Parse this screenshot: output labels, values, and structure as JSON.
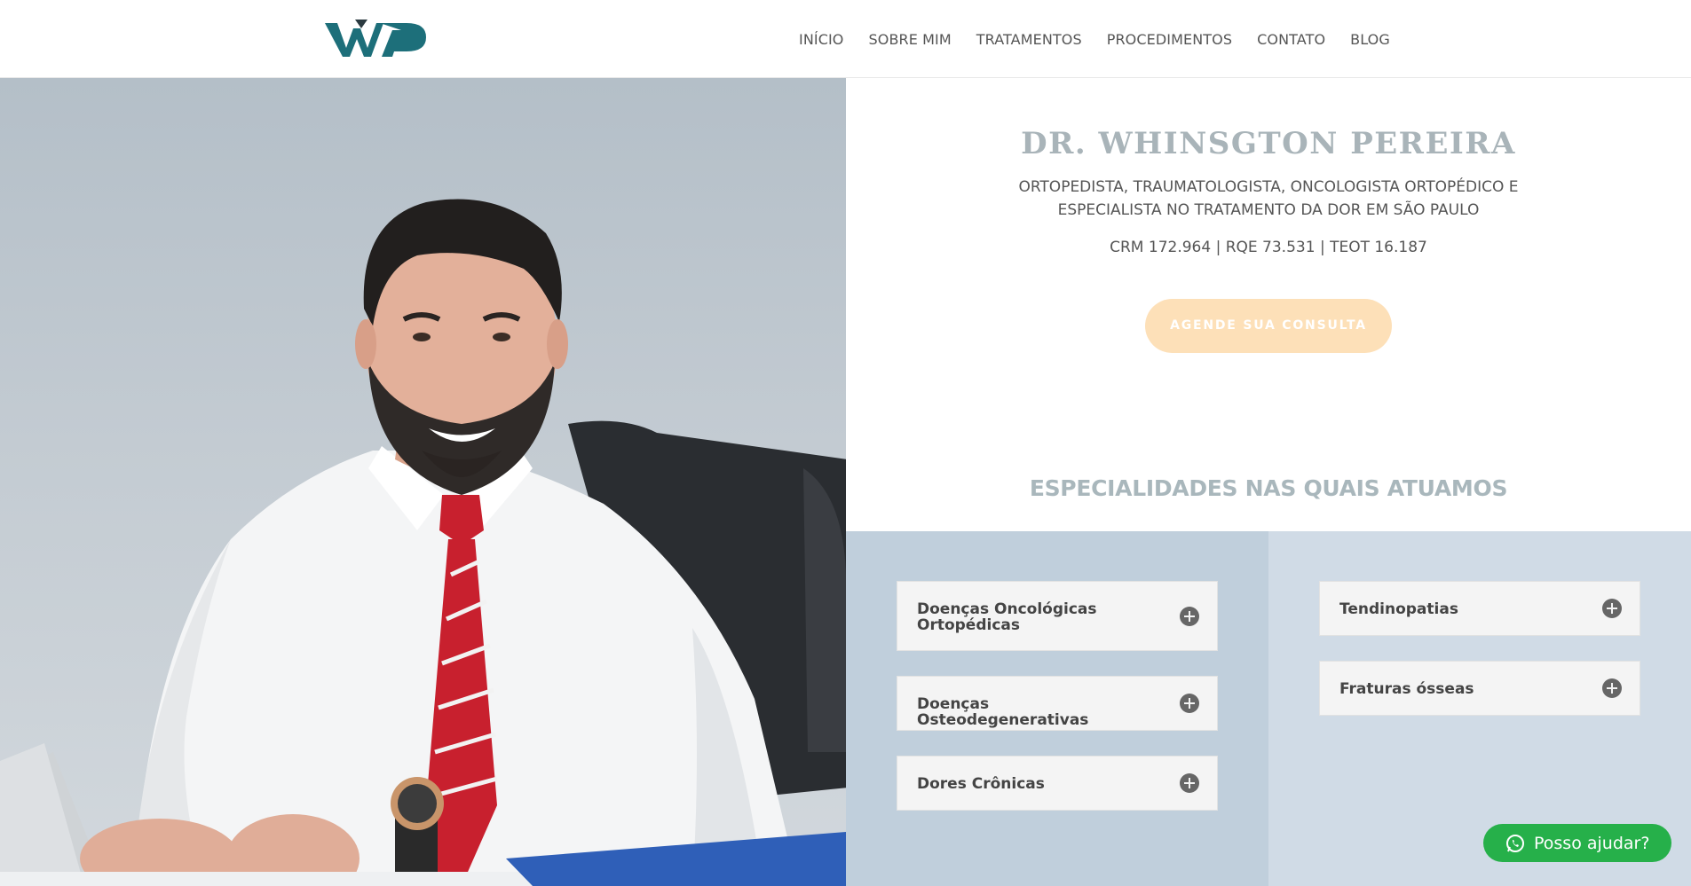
{
  "header": {
    "logo_text": "WP",
    "nav": [
      "INÍCIO",
      "SOBRE MIM",
      "TRATAMENTOS",
      "PROCEDIMENTOS",
      "CONTATO",
      "BLOG"
    ]
  },
  "hero": {
    "title": "DR. WHINSGTON PEREIRA",
    "subtitle_line1": "ORTOPEDISTA, TRAUMATOLOGISTA, ONCOLOGISTA ORTOPÉDICO E",
    "subtitle_line2": "ESPECIALISTA NO TRATAMENTO DA DOR EM SÃO PAULO",
    "credentials": "CRM 172.964 | RQE 73.531 | TEOT 16.187",
    "cta_label": "AGENDE SUA CONSULTA"
  },
  "specialties": {
    "heading": "ESPECIALIDADES NAS QUAIS ATUAMOS",
    "left": [
      {
        "line1": "Doenças Oncológicas",
        "line2": "Ortopédicas"
      },
      {
        "line1": "Doenças Osteodegenerativas",
        "line2": ""
      },
      {
        "line1": "Dores Crônicas",
        "line2": ""
      }
    ],
    "right": [
      {
        "line1": "Tendinopatias",
        "line2": ""
      },
      {
        "line1": "Fraturas ósseas",
        "line2": ""
      }
    ]
  },
  "whatsapp": {
    "label": "Posso ajudar?"
  },
  "colors": {
    "brand_teal": "#1d6f7a",
    "logo_dark": "#2b3a40",
    "cta": "#fde0b8",
    "whatsapp": "#26b04a",
    "panel_left": "#c0cfdc",
    "panel_right": "#d0dbe6"
  },
  "icons": [
    "plus-circle-icon",
    "whatsapp-icon"
  ]
}
